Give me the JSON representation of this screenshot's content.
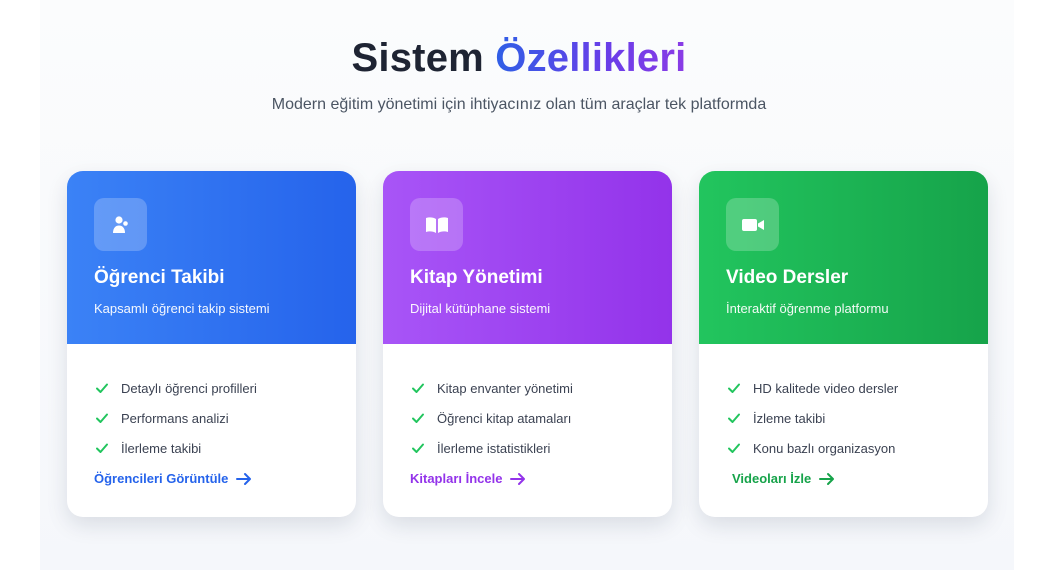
{
  "header": {
    "title_main": "Sistem",
    "title_accent": "Özellikleri",
    "subtitle": "Modern eğitim yönetimi için ihtiyacınız olan tüm araçlar tek platformda"
  },
  "cards": [
    {
      "icon": "users-icon",
      "title": "Öğrenci Takibi",
      "description": "Kapsamlı öğrenci takip sistemi",
      "features": [
        "Detaylı öğrenci profilleri",
        "Performans analizi",
        "İlerleme takibi"
      ],
      "action_label": "Öğrencileri Görüntüle",
      "color": "#2563eb"
    },
    {
      "icon": "book-icon",
      "title": "Kitap Yönetimi",
      "description": "Dijital kütüphane sistemi",
      "features": [
        "Kitap envanter yönetimi",
        "Öğrenci kitap atamaları",
        "İlerleme istatistikleri"
      ],
      "action_label": "Kitapları İncele",
      "color": "#9333ea"
    },
    {
      "icon": "video-icon",
      "title": "Video Dersler",
      "description": "İnteraktif öğrenme platformu",
      "features": [
        "HD kalitede video dersler",
        "İzleme takibi",
        "Konu bazlı organizasyon"
      ],
      "action_label": "Videoları İzle",
      "color": "#16a34a"
    }
  ],
  "colors": {
    "check": "#22c55e",
    "title": "#1e2433"
  }
}
